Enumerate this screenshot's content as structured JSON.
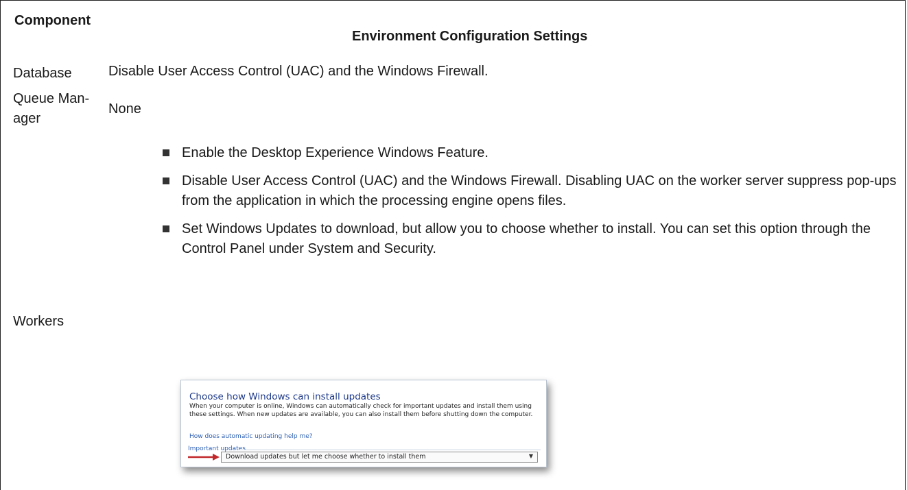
{
  "table": {
    "header": {
      "component": "Component",
      "settings": "Environment Configuration Settings"
    },
    "rows": [
      {
        "component": "Database",
        "settings": "Disable User Access Control (UAC) and the Windows Firewall."
      },
      {
        "component": "Queue Man-ager",
        "component_line1": "Queue Man-",
        "component_line2": "ager",
        "settings": "None"
      },
      {
        "component": "Workers",
        "settings_list": [
          "Enable the Desktop Experience Windows Feature.",
          "Disable User Access Control (UAC) and the Windows Firewall. Disabling UAC on the worker server suppress pop-ups from the application in which the processing engine opens files.",
          "Set Windows Updates to download, but allow you to choose whether to install. You can set this option through the Control Panel under System and Security."
        ]
      }
    ]
  },
  "dialog": {
    "title": "Choose how Windows can install updates",
    "description": "When your computer is online, Windows can automatically check for important updates and install them using these settings. When new updates are available, you can also install them before shutting down the computer.",
    "help_link": "How does automatic updating help me?",
    "group_label": "Important updates",
    "selected_option": "Download updates but let me choose whether to install them",
    "arrow_color": "#c0282b",
    "icons": {
      "dropdown": "chevron-down-icon",
      "pointer": "red-arrow-icon"
    }
  }
}
